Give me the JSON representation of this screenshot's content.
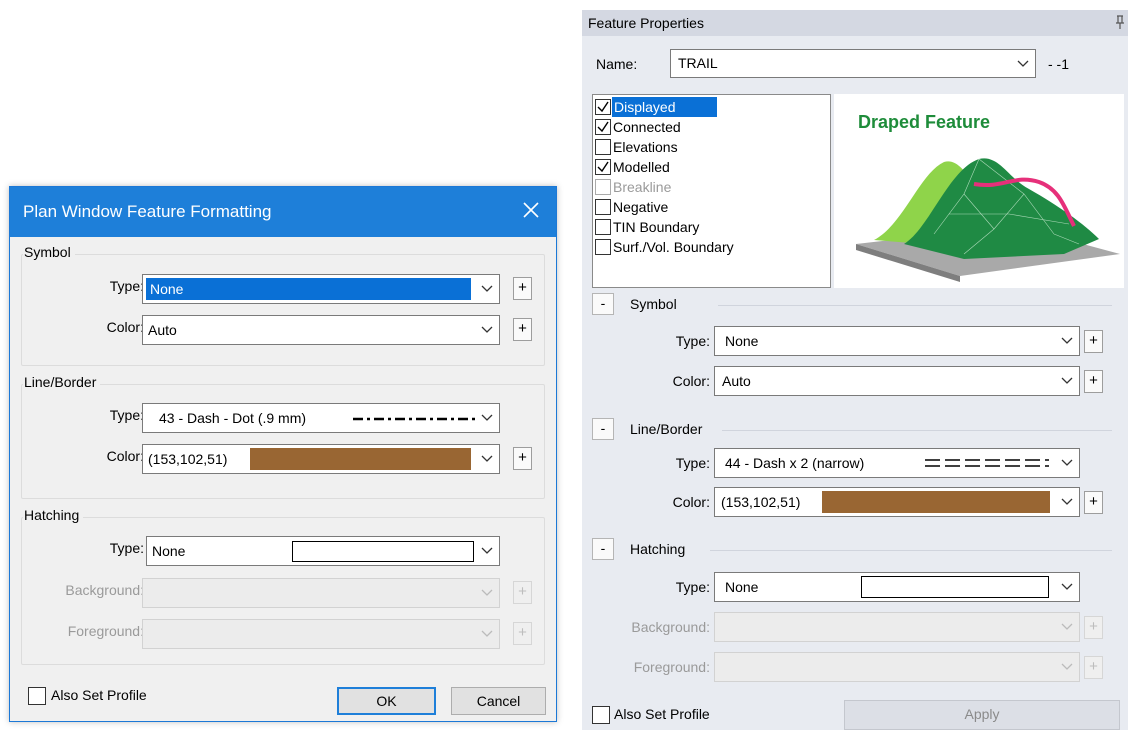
{
  "dialog": {
    "title": "Plan Window Feature Formatting",
    "symbol": {
      "title": "Symbol",
      "type_label": "Type:",
      "type_value": "None",
      "color_label": "Color:",
      "color_value": "Auto"
    },
    "line_border": {
      "title": "Line/Border",
      "type_label": "Type:",
      "type_value": "43 - Dash - Dot (.9 mm)",
      "color_label": "Color:",
      "color_value": "(153,102,51)",
      "swatch_color": "#996633"
    },
    "hatching": {
      "title": "Hatching",
      "type_label": "Type:",
      "type_value": "None",
      "background_label": "Background:",
      "foreground_label": "Foreground:"
    },
    "also_set_profile": "Also Set Profile",
    "ok": "OK",
    "cancel": "Cancel"
  },
  "panel": {
    "title": "Feature Properties",
    "name_label": "Name:",
    "name_value": "TRAIL",
    "name_suffix": "- -1",
    "features": [
      {
        "label": "Displayed",
        "checked": true
      },
      {
        "label": "Connected",
        "checked": true
      },
      {
        "label": "Elevations",
        "checked": false
      },
      {
        "label": "Modelled",
        "checked": true
      },
      {
        "label": "Breakline",
        "checked": false
      },
      {
        "label": "Negative",
        "checked": false
      },
      {
        "label": "TIN Boundary",
        "checked": false
      },
      {
        "label": "Surf./Vol. Boundary",
        "checked": false
      }
    ],
    "preview_title": "Draped Feature",
    "symbol": {
      "title": "Symbol",
      "type_label": "Type:",
      "type_value": "None",
      "color_label": "Color:",
      "color_value": "Auto"
    },
    "line_border": {
      "title": "Line/Border",
      "type_label": "Type:",
      "type_value": "44 - Dash x 2 (narrow)",
      "color_label": "Color:",
      "color_value": "(153,102,51)",
      "swatch_color": "#996633"
    },
    "hatching": {
      "title": "Hatching",
      "type_label": "Type:",
      "type_value": "None",
      "background_label": "Background:",
      "foreground_label": "Foreground:"
    },
    "also_set_profile": "Also Set Profile",
    "apply": "Apply",
    "collapse_symbol": "-"
  }
}
